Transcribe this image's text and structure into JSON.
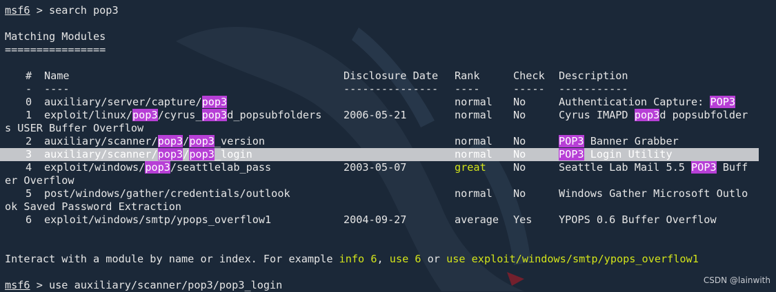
{
  "prompt": {
    "label": "msf6",
    "separator": " > "
  },
  "command1": "search pop3",
  "heading": "Matching Modules",
  "heading_rule": "================",
  "columns": {
    "num": "#",
    "name": "Name",
    "date": "Disclosure Date",
    "rank": "Rank",
    "check": "Check",
    "desc": "Description"
  },
  "dashes": {
    "num": "-",
    "name": "----",
    "date": "---------------",
    "rank": "----",
    "check": "-----",
    "desc": "-----------"
  },
  "rows": [
    {
      "index": "0",
      "name": [
        "auxiliary/server/capture/",
        {
          "hl": "pop3"
        }
      ],
      "date": "",
      "rank": "normal",
      "check": "No",
      "desc": [
        "Authentication Capture: ",
        {
          "hl": "POP3"
        }
      ],
      "wrap": ""
    },
    {
      "index": "1",
      "name": [
        "exploit/linux/",
        {
          "hl": "pop3"
        },
        "/cyrus_",
        {
          "hl": "pop3"
        },
        "d_popsubfolders"
      ],
      "date": "2006-05-21",
      "rank": "normal",
      "check": "No",
      "desc": [
        "Cyrus IMAPD ",
        {
          "hl": "pop3"
        },
        "d popsubfolder"
      ],
      "wrap": "s USER Buffer Overflow"
    },
    {
      "index": "2",
      "name": [
        "auxiliary/scanner/",
        {
          "hl": "pop3"
        },
        "/",
        {
          "hl": "pop3"
        },
        "_version"
      ],
      "date": "",
      "rank": "normal",
      "check": "No",
      "desc": [
        {
          "hl": "POP3"
        },
        " Banner Grabber"
      ],
      "wrap": ""
    },
    {
      "index": "3",
      "name": [
        "auxiliary/scanner/",
        {
          "hl": "pop3"
        },
        "/",
        {
          "hl": "pop3"
        },
        "_login"
      ],
      "date": "",
      "rank": "normal",
      "check": "No",
      "desc": [
        {
          "hl": "POP3"
        },
        " Login Utility"
      ],
      "wrap": "",
      "selected": true
    },
    {
      "index": "4",
      "name": [
        "exploit/windows/",
        {
          "hl": "pop3"
        },
        "/seattlelab_pass"
      ],
      "date": "2003-05-07",
      "rank": "great",
      "check": "No",
      "desc": [
        "Seattle Lab Mail 5.5 ",
        {
          "hl": "POP3"
        },
        " Buff"
      ],
      "wrap": "er Overflow"
    },
    {
      "index": "5",
      "name": [
        "post/windows/gather/credentials/outlook"
      ],
      "date": "",
      "rank": "normal",
      "check": "No",
      "desc": [
        "Windows Gather Microsoft Outlo"
      ],
      "wrap": "ok Saved Password Extraction"
    },
    {
      "index": "6",
      "name": [
        "exploit/windows/smtp/ypops_overflow1"
      ],
      "date": "2004-09-27",
      "rank": "average",
      "check": "Yes",
      "desc": [
        "YPOPS 0.6 Buffer Overflow"
      ],
      "wrap": ""
    }
  ],
  "interact": {
    "prefix": "Interact with a module by name or index. For example ",
    "ex1": "info 6",
    "sep1": ", ",
    "ex2": "use 6",
    "sep2": " or ",
    "ex3": "use exploit/windows/smtp/ypops_overflow1"
  },
  "command2": "use auxiliary/scanner/pop3/pop3_login",
  "watermark": "CSDN @lainwith",
  "colors": {
    "background": "#1b2838",
    "highlight": "#b73fd6",
    "accent_yellow": "#d3e41a",
    "selection": "#c4c6ca"
  }
}
